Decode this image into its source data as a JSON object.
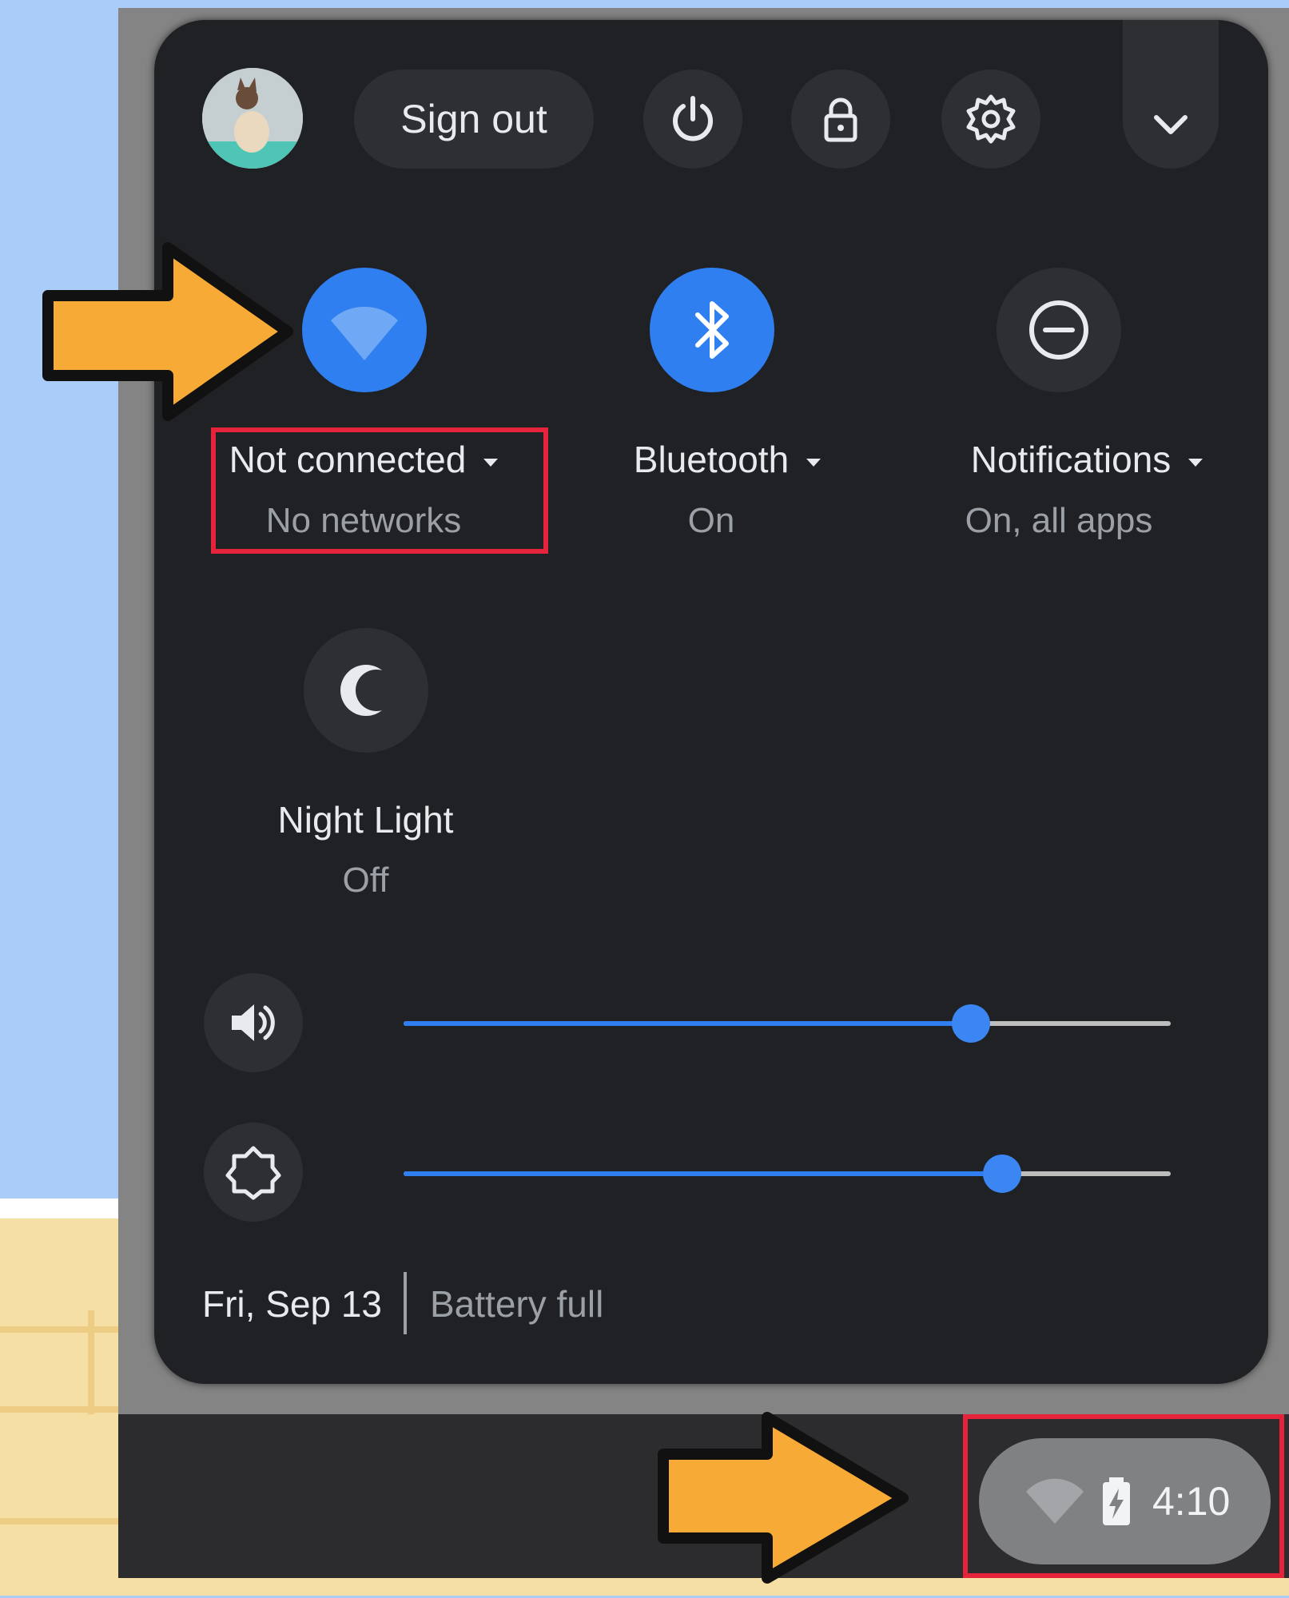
{
  "header": {
    "sign_out_label": "Sign out"
  },
  "tiles": {
    "network": {
      "label": "Not connected",
      "status": "No networks"
    },
    "bluetooth": {
      "label": "Bluetooth",
      "status": "On"
    },
    "notifications": {
      "label": "Notifications",
      "status": "On, all apps"
    },
    "night_light": {
      "label": "Night Light",
      "status": "Off"
    }
  },
  "sliders": {
    "volume_level": 0.74,
    "brightness_level": 0.78
  },
  "footer": {
    "date": "Fri, Sep 13",
    "battery": "Battery full"
  },
  "tray": {
    "time": "4:10"
  },
  "colors": {
    "accent": "#2f7ff0",
    "panel": "#202124",
    "annotation_box": "#e5243b",
    "annotation_arrow": "#f8aa36"
  }
}
